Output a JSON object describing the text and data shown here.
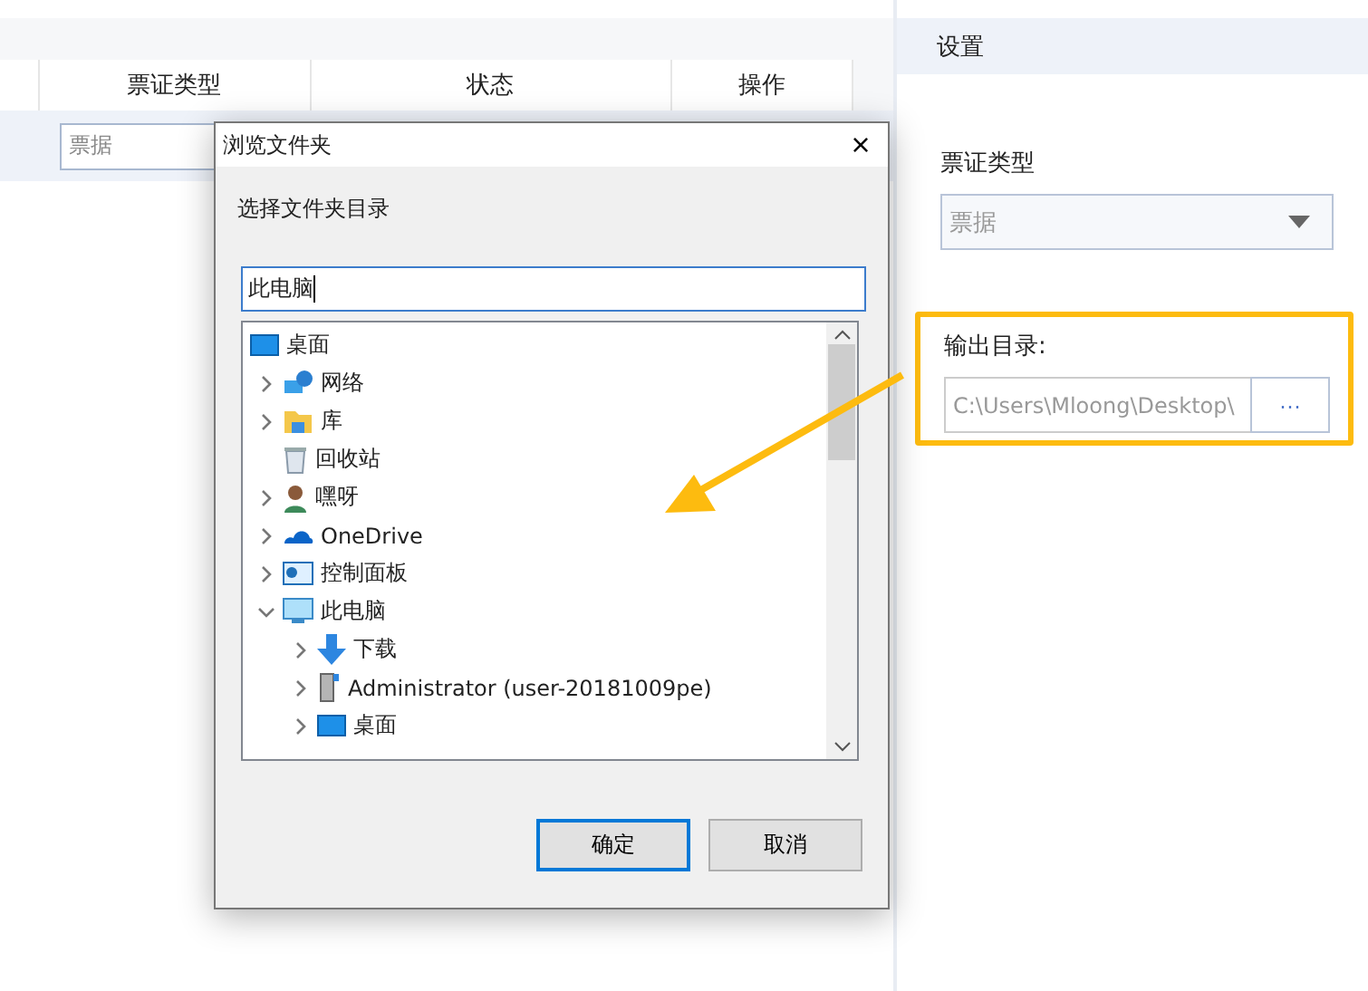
{
  "table": {
    "columns": [
      "",
      "票证类型",
      "状态",
      "操作"
    ],
    "filter": {
      "value": "票据"
    }
  },
  "settings": {
    "title": "设置",
    "voucher_label": "票证类型",
    "voucher_select": {
      "value": "票据",
      "disabled": true
    },
    "output_label": "输出目录:",
    "output_path": "C:\\Users\\Mloong\\Desktop\\",
    "browse_button": "···",
    "highlighted": true
  },
  "dialog": {
    "title": "浏览文件夹",
    "close": "×",
    "prompt": "选择文件夹目录",
    "path": "此电脑",
    "tree": [
      {
        "label": "桌面",
        "kind": "desktop",
        "children": [
          {
            "label": "网络",
            "kind": "network",
            "expanded": false
          },
          {
            "label": "库",
            "kind": "library",
            "expanded": false
          },
          {
            "label": "回收站",
            "kind": "recycle"
          },
          {
            "label": "嘿呀",
            "kind": "user",
            "expanded": false
          },
          {
            "label": "OneDrive",
            "kind": "cloud",
            "expanded": false
          },
          {
            "label": "控制面板",
            "kind": "control-panel",
            "expanded": false
          },
          {
            "label": "此电脑",
            "kind": "computer",
            "expanded": true,
            "children": [
              {
                "label": "下载",
                "kind": "download",
                "expanded": false
              },
              {
                "label": "Administrator (user-20181009pe)",
                "kind": "user-folder",
                "expanded": false
              },
              {
                "label": "桌面",
                "kind": "desktop",
                "expanded": false
              }
            ]
          }
        ]
      }
    ],
    "buttons": [
      {
        "label": "确定",
        "default": true
      },
      {
        "label": "取消",
        "default": false
      }
    ]
  }
}
